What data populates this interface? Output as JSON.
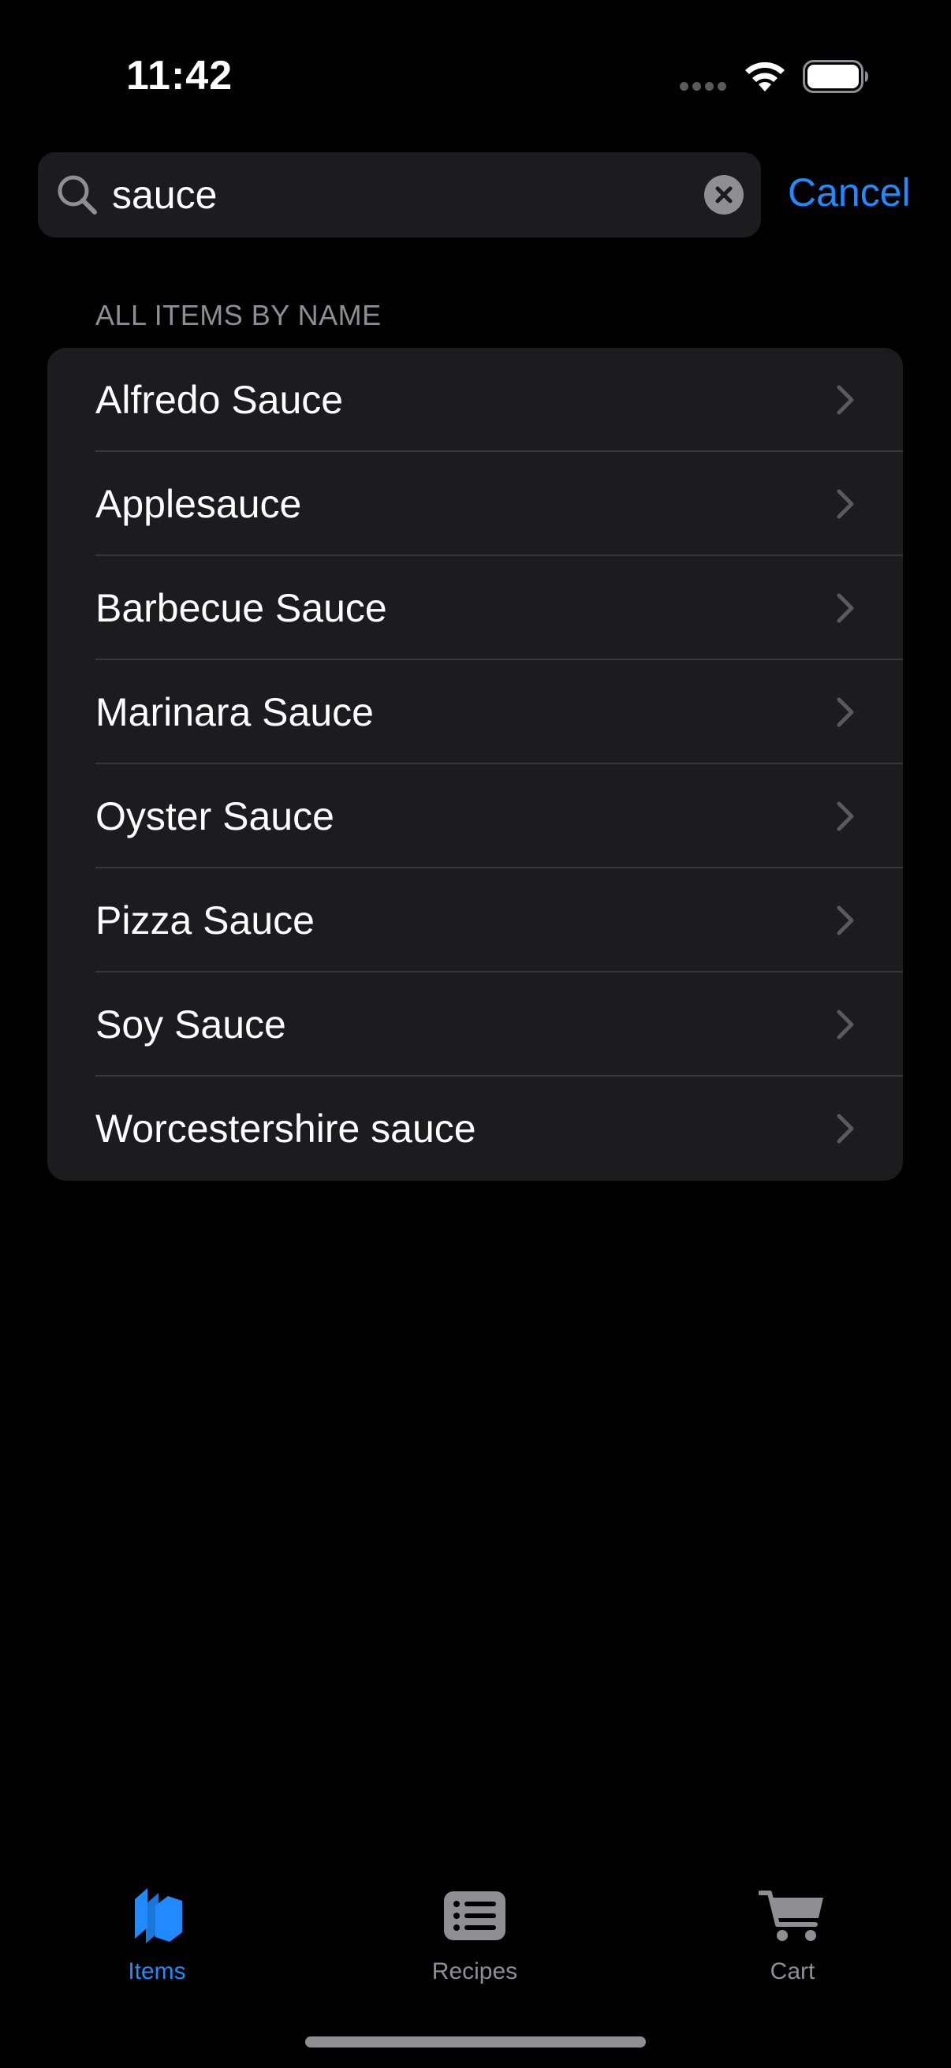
{
  "status_bar": {
    "time": "11:42"
  },
  "search": {
    "value": "sauce",
    "cancel_label": "Cancel"
  },
  "section": {
    "header": "ALL ITEMS BY NAME",
    "items": [
      "Alfredo Sauce",
      "Applesauce",
      "Barbecue Sauce",
      "Marinara Sauce",
      "Oyster Sauce",
      "Pizza Sauce",
      "Soy Sauce",
      "Worcestershire sauce"
    ]
  },
  "tab_bar": {
    "tabs": [
      {
        "label": "Items",
        "icon": "items-icon",
        "selected": true
      },
      {
        "label": "Recipes",
        "icon": "recipes-icon",
        "selected": false
      },
      {
        "label": "Cart",
        "icon": "cart-icon",
        "selected": false
      }
    ]
  },
  "colors": {
    "background": "#000000",
    "surface": "#1c1c1e",
    "accent": "#1f8bff",
    "secondary_text": "#8e8e93",
    "separator": "#38383a"
  }
}
